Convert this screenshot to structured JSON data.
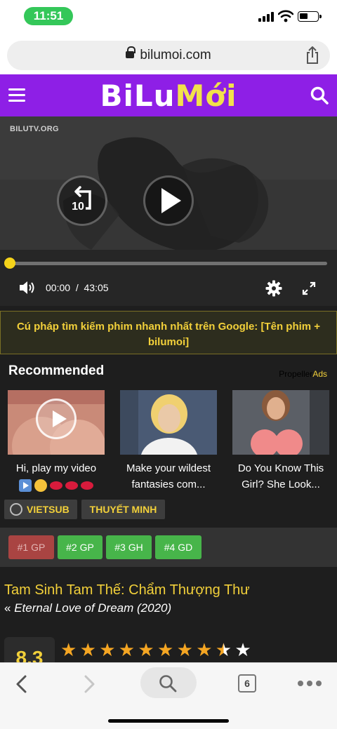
{
  "status_bar": {
    "time": "11:51"
  },
  "browser": {
    "url": "bilumoi.com",
    "tab_count": "6"
  },
  "site": {
    "logo_part1": "BiLu",
    "logo_part2": "Mới"
  },
  "player": {
    "watermark": "BILUTV.ORG",
    "rewind_label": "10",
    "current_time": "00:00",
    "separator": "/",
    "duration": "43:05",
    "progress": 0.0
  },
  "notice": {
    "text": "Cú pháp tìm kiếm phim nhanh nhất trên Google: [Tên phim + bilumoi]"
  },
  "recommended": {
    "heading": "Recommended",
    "ads_prefix": "Propeller",
    "ads_suffix": "Ads",
    "items": [
      {
        "title": "Hi, play my video"
      },
      {
        "title": "Make your wildest fantasies com..."
      },
      {
        "title": "Do You Know This Girl? She Look..."
      }
    ]
  },
  "languages": {
    "vietsub": "VIETSUB",
    "thuyet_minh": "THUYẾT MINH"
  },
  "servers": [
    "#1 GP",
    "#2 GP",
    "#3 GH",
    "#4 GD"
  ],
  "movie": {
    "title": "Tam Sinh Tam Thế: Chẩm Thượng Thư",
    "quote_mark": "«",
    "subtitle": "Eternal Love of Dream (2020)",
    "score": "8.3",
    "stars_filled": 8.5,
    "stars_total": 10
  },
  "colors": {
    "header_purple": "#8e1fe6",
    "accent_yellow": "#f2d03a",
    "server_active_red": "#a94442",
    "server_green": "#47b54a",
    "status_green": "#34c759"
  }
}
